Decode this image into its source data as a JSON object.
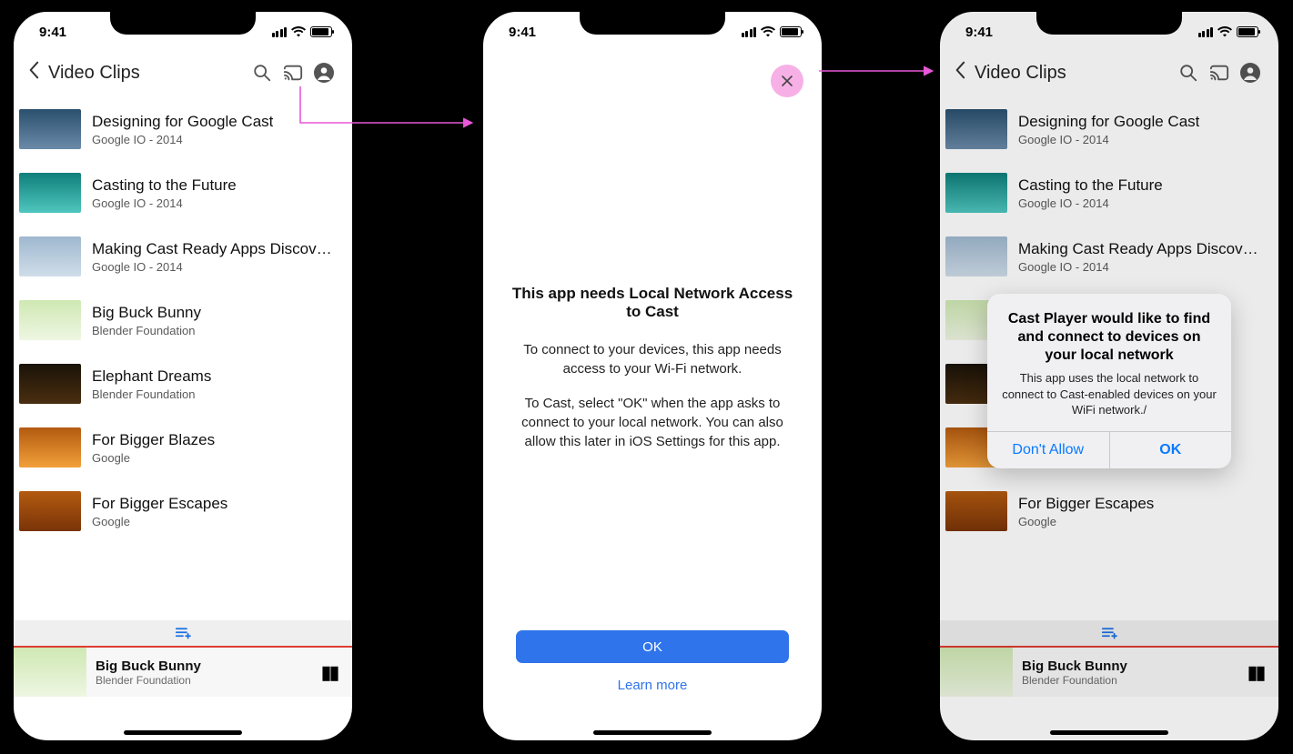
{
  "status": {
    "time": "9:41"
  },
  "header": {
    "title": "Video Clips"
  },
  "videos": [
    {
      "title": "Designing for Google Cast",
      "sub": "Google IO - 2014",
      "thumb": "t1"
    },
    {
      "title": "Casting to the Future",
      "sub": "Google IO - 2014",
      "thumb": "t2"
    },
    {
      "title": "Making Cast Ready Apps Discover...",
      "sub": "Google IO - 2014",
      "thumb": "t3"
    },
    {
      "title": "Big Buck Bunny",
      "sub": "Blender Foundation",
      "thumb": "t4"
    },
    {
      "title": "Elephant Dreams",
      "sub": "Blender Foundation",
      "thumb": "t5"
    },
    {
      "title": "For Bigger Blazes",
      "sub": "Google",
      "thumb": "t6"
    },
    {
      "title": "For Bigger Escapes",
      "sub": "Google",
      "thumb": "t7"
    }
  ],
  "now_playing": {
    "title": "Big Buck Bunny",
    "sub": "Blender Foundation"
  },
  "interstitial": {
    "heading": "This app needs Local Network Access to Cast",
    "p1": "To connect to your devices, this app needs access to your Wi-Fi network.",
    "p2": "To Cast, select \"OK\" when the app asks to connect to your local network. You can also allow this later in iOS Settings for this app.",
    "ok": "OK",
    "learn": "Learn more"
  },
  "alert": {
    "title": "Cast Player would like to find and connect to devices on your local network",
    "msg": "This app uses the local network to connect to Cast-enabled devices on your WiFi network./",
    "dont": "Don't Allow",
    "ok": "OK"
  }
}
